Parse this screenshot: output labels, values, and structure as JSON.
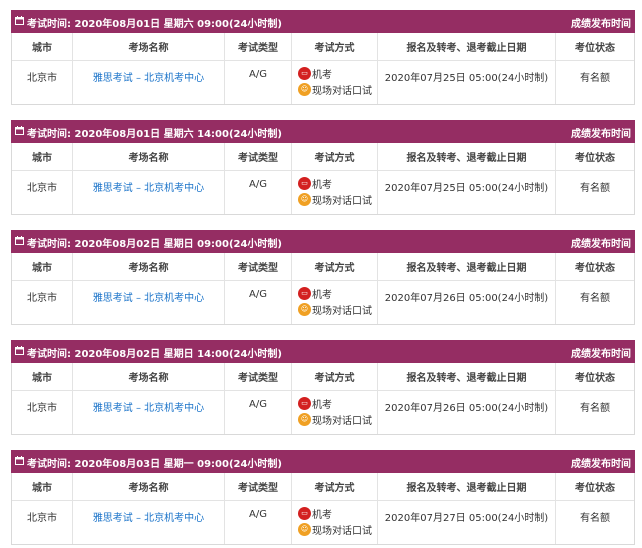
{
  "columns": {
    "city": "城市",
    "venue": "考场名称",
    "type": "考试类型",
    "method": "考试方式",
    "deadline": "报名及转考、退考截止日期",
    "status": "考位状态"
  },
  "header_right": "成绩发布时间",
  "exams": [
    {
      "title": "考试时间: 2020年08月01日 星期六 09:00(24小时制)",
      "city": "北京市",
      "venue": "雅思考试 – 北京机考中心",
      "type": "A/G",
      "methods": [
        "机考",
        "现场对话口试"
      ],
      "deadline": "2020年07月25日 05:00(24小时制)",
      "status": "有名额"
    },
    {
      "title": "考试时间: 2020年08月01日 星期六 14:00(24小时制)",
      "city": "北京市",
      "venue": "雅思考试 – 北京机考中心",
      "type": "A/G",
      "methods": [
        "机考",
        "现场对话口试"
      ],
      "deadline": "2020年07月25日 05:00(24小时制)",
      "status": "有名额"
    },
    {
      "title": "考试时间: 2020年08月02日 星期日 09:00(24小时制)",
      "city": "北京市",
      "venue": "雅思考试 – 北京机考中心",
      "type": "A/G",
      "methods": [
        "机考",
        "现场对话口试"
      ],
      "deadline": "2020年07月26日 05:00(24小时制)",
      "status": "有名额"
    },
    {
      "title": "考试时间: 2020年08月02日 星期日 14:00(24小时制)",
      "city": "北京市",
      "venue": "雅思考试 – 北京机考中心",
      "type": "A/G",
      "methods": [
        "机考",
        "现场对话口试"
      ],
      "deadline": "2020年07月26日 05:00(24小时制)",
      "status": "有名额"
    },
    {
      "title": "考试时间: 2020年08月03日 星期一 09:00(24小时制)",
      "city": "北京市",
      "venue": "雅思考试 – 北京机考中心",
      "type": "A/G",
      "methods": [
        "机考",
        "现场对话口试"
      ],
      "deadline": "2020年07月27日 05:00(24小时制)",
      "status": "有名额"
    }
  ],
  "icons": {
    "calendar": "calendar-icon",
    "computer": "computer-icon",
    "face_to_face": "speaking-icon"
  },
  "colors": {
    "header_bg": "#952d63",
    "link": "#1a73c9",
    "computer_icon": "#d32020",
    "speaking_icon": "#f0a023"
  }
}
